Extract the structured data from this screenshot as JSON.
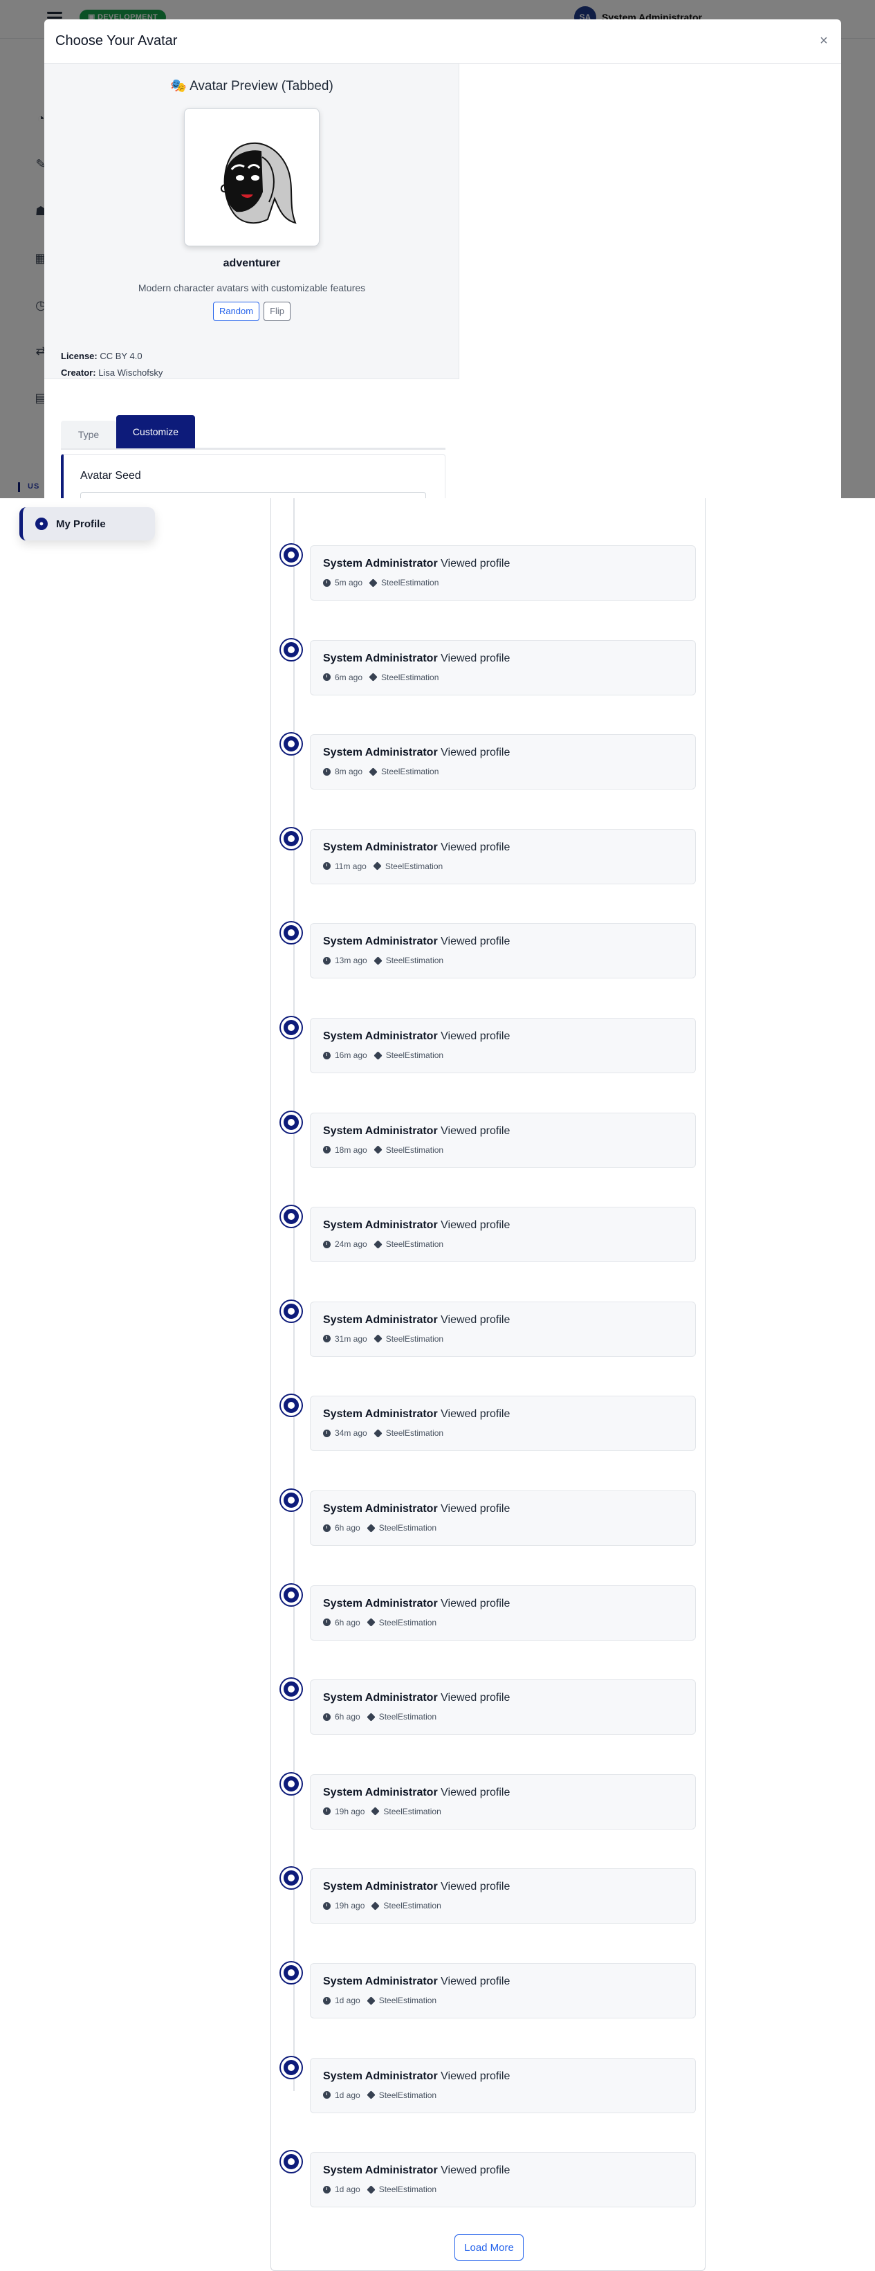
{
  "topbar": {
    "env_badge": "▣ DEVELOPMENT",
    "user_initials": "SA",
    "user_name": "System Administrator"
  },
  "sidebar": {
    "section_label": "US",
    "active_item": "My Profile"
  },
  "modal": {
    "title": "Choose Your Avatar",
    "close_symbol": "×",
    "preview_heading": "🎭 Avatar Preview (Tabbed)",
    "style_name": "adventurer",
    "description": "Modern character avatars with customizable features",
    "random_label": "Random",
    "flip_label": "Flip",
    "license_label": "License:",
    "license_value": "CC BY 4.0",
    "creator_label": "Creator:",
    "creator_value": "Lisa Wischofsky",
    "tabs": [
      {
        "label": "Type"
      },
      {
        "label": "Customize"
      }
    ],
    "seed_label": "Avatar Seed"
  },
  "activity": {
    "items": [
      {
        "user": "System Administrator",
        "action": "Viewed profile",
        "time": "5m ago",
        "app": "SteelEstimation"
      },
      {
        "user": "System Administrator",
        "action": "Viewed profile",
        "time": "6m ago",
        "app": "SteelEstimation"
      },
      {
        "user": "System Administrator",
        "action": "Viewed profile",
        "time": "8m ago",
        "app": "SteelEstimation"
      },
      {
        "user": "System Administrator",
        "action": "Viewed profile",
        "time": "11m ago",
        "app": "SteelEstimation"
      },
      {
        "user": "System Administrator",
        "action": "Viewed profile",
        "time": "13m ago",
        "app": "SteelEstimation"
      },
      {
        "user": "System Administrator",
        "action": "Viewed profile",
        "time": "16m ago",
        "app": "SteelEstimation"
      },
      {
        "user": "System Administrator",
        "action": "Viewed profile",
        "time": "18m ago",
        "app": "SteelEstimation"
      },
      {
        "user": "System Administrator",
        "action": "Viewed profile",
        "time": "24m ago",
        "app": "SteelEstimation"
      },
      {
        "user": "System Administrator",
        "action": "Viewed profile",
        "time": "31m ago",
        "app": "SteelEstimation"
      },
      {
        "user": "System Administrator",
        "action": "Viewed profile",
        "time": "34m ago",
        "app": "SteelEstimation"
      },
      {
        "user": "System Administrator",
        "action": "Viewed profile",
        "time": "6h ago",
        "app": "SteelEstimation"
      },
      {
        "user": "System Administrator",
        "action": "Viewed profile",
        "time": "6h ago",
        "app": "SteelEstimation"
      },
      {
        "user": "System Administrator",
        "action": "Viewed profile",
        "time": "6h ago",
        "app": "SteelEstimation"
      },
      {
        "user": "System Administrator",
        "action": "Viewed profile",
        "time": "19h ago",
        "app": "SteelEstimation"
      },
      {
        "user": "System Administrator",
        "action": "Viewed profile",
        "time": "19h ago",
        "app": "SteelEstimation"
      },
      {
        "user": "System Administrator",
        "action": "Viewed profile",
        "time": "1d ago",
        "app": "SteelEstimation"
      },
      {
        "user": "System Administrator",
        "action": "Viewed profile",
        "time": "1d ago",
        "app": "SteelEstimation"
      },
      {
        "user": "System Administrator",
        "action": "Viewed profile",
        "time": "1d ago",
        "app": "SteelEstimation"
      }
    ],
    "load_more_label": "Load More"
  }
}
